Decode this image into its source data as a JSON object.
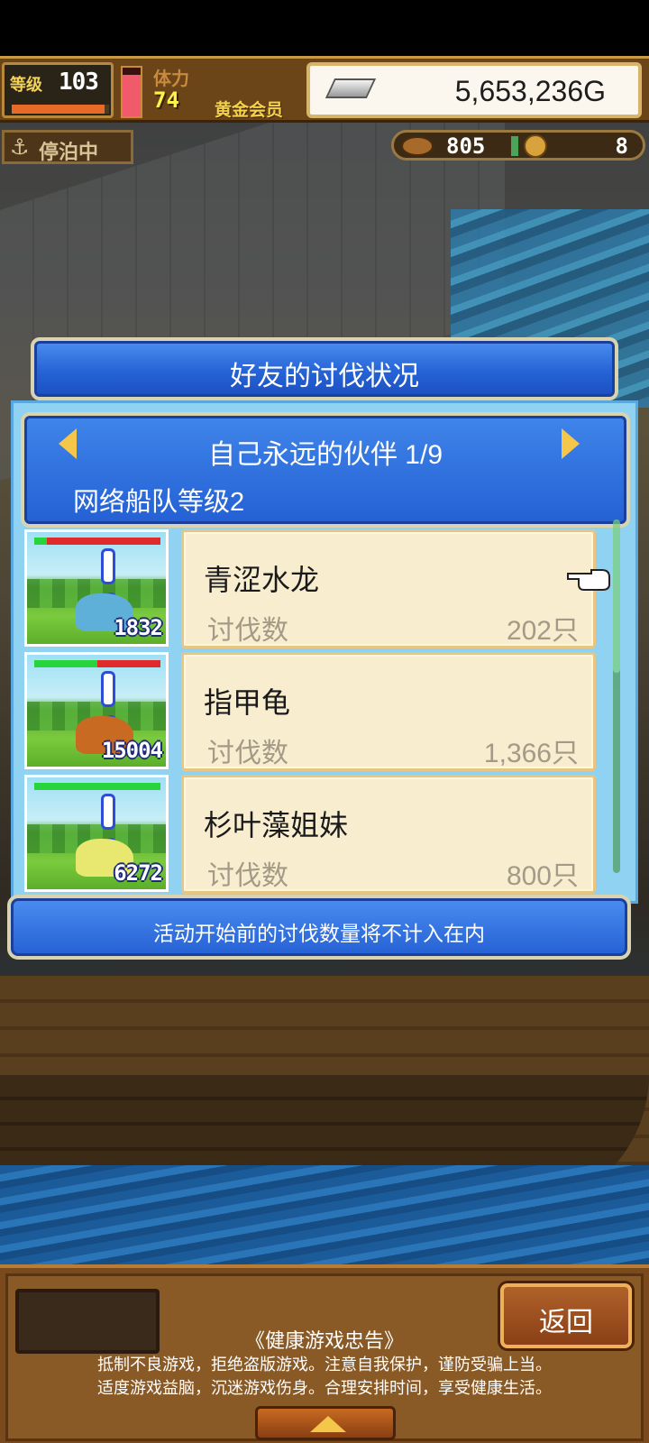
{
  "hud": {
    "level_label": "等级",
    "level_value": "103",
    "level_exp_fraction": 0.95,
    "hp_fraction": 0.85,
    "stamina_label": "体力",
    "stamina_value": "74",
    "membership": "黄金会员",
    "gold": "5,653,236G",
    "status": "停泊中",
    "resource1": "805",
    "resource2": "8",
    "icons": [
      "ingot-icon",
      "anchor-icon",
      "fish-icon",
      "medal-icon"
    ]
  },
  "dialog": {
    "title": "好友的讨伐状况",
    "friend_name": "自己永远的伙伴 1/9",
    "fleet_level": "网络船队等级2",
    "kill_label": "讨伐数",
    "notice": "活动开始前的讨伐数量将不计入在内",
    "entries": [
      {
        "name": "青涩水龙",
        "kills": "202只",
        "total": "1832",
        "hp_green": 0.1,
        "hp_red": 0.9,
        "monster_color": "#5fb0d8"
      },
      {
        "name": "指甲龟",
        "kills": "1,366只",
        "total": "15004",
        "hp_green": 0.5,
        "hp_red": 0.5,
        "monster_color": "#c86a22"
      },
      {
        "name": "杉叶藻姐妹",
        "kills": "800只",
        "total": "6272",
        "hp_green": 1.0,
        "hp_red": 0.0,
        "monster_color": "#e8e870"
      }
    ]
  },
  "bottom": {
    "back_label": "返回",
    "health_title": "《健康游戏忠告》",
    "health_line1": "抵制不良游戏，拒绝盗版游戏。注意自我保护，谨防受骗上当。",
    "health_line2": "适度游戏益脑，沉迷游戏伤身。合理安排时间，享受健康生活。"
  }
}
